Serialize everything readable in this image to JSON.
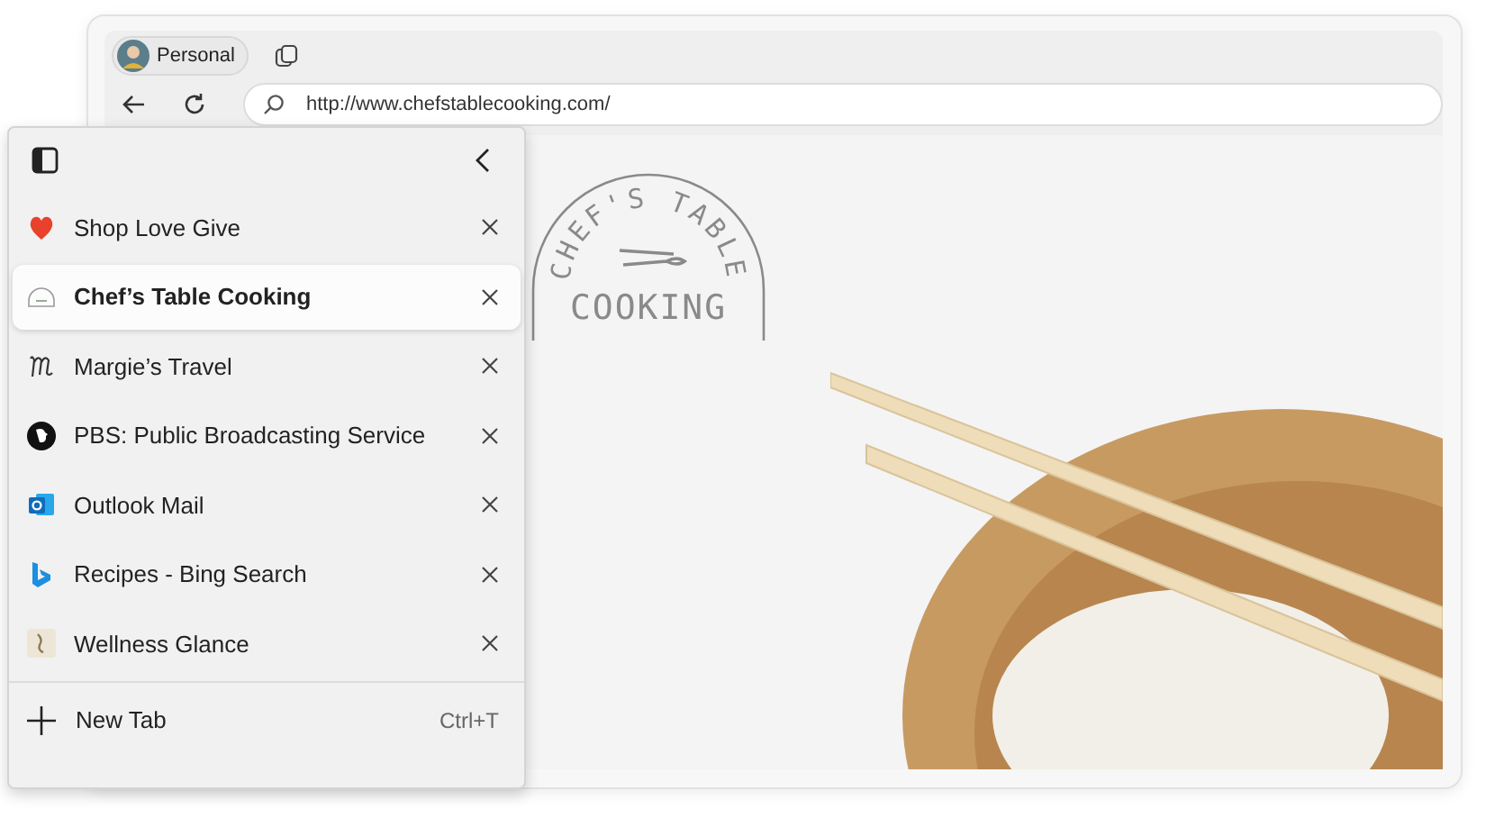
{
  "profile": {
    "label": "Personal"
  },
  "address_bar": {
    "url": "http://www.chefstablecooking.com/"
  },
  "page_logo": {
    "arc_text": "CHEF'S TABLE",
    "word": "COOKING"
  },
  "vertical_tabs": {
    "tabs": [
      {
        "title": "Shop Love Give",
        "kind": "heart",
        "selected": false
      },
      {
        "title": "Chef’s Table Cooking",
        "kind": "chef",
        "selected": true
      },
      {
        "title": "Margie’s Travel",
        "kind": "script",
        "selected": false
      },
      {
        "title": "PBS: Public Broadcasting Service",
        "kind": "pbs",
        "selected": false
      },
      {
        "title": "Outlook Mail",
        "kind": "outlook",
        "selected": false
      },
      {
        "title": "Recipes - Bing Search",
        "kind": "bing",
        "selected": false
      },
      {
        "title": "Wellness Glance",
        "kind": "wellness",
        "selected": false
      }
    ],
    "new_tab": {
      "label": "New Tab",
      "shortcut": "Ctrl+T"
    }
  }
}
